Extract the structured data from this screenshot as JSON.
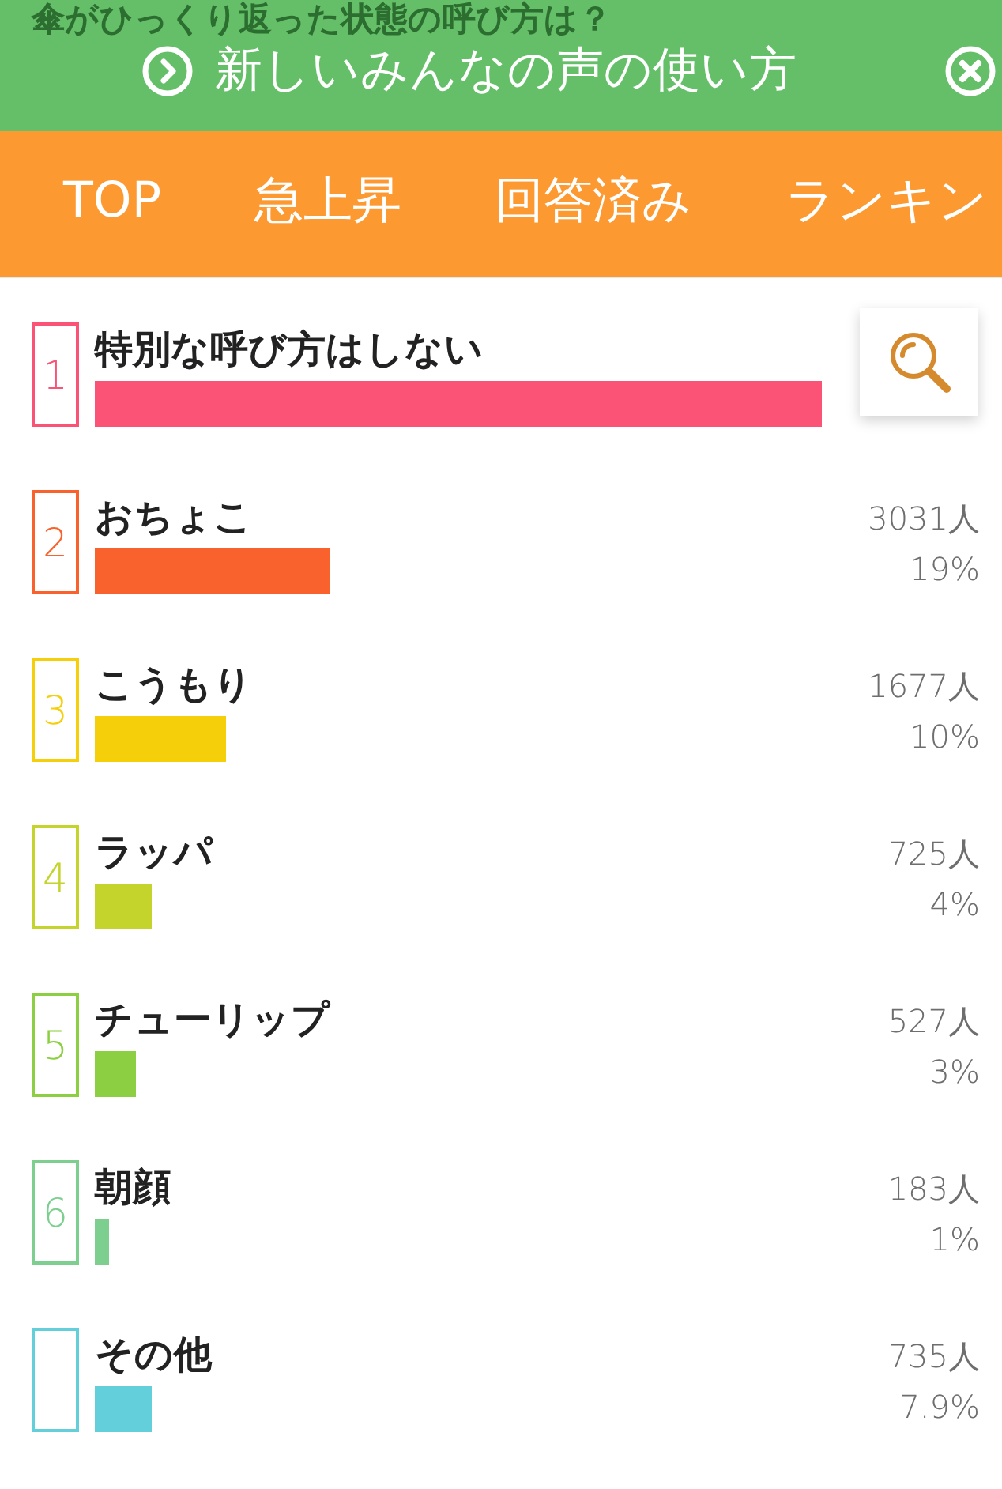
{
  "question_title": "傘がひっくり返った状態の呼び方は？",
  "banner": {
    "text": "新しいみんなの声の使い方"
  },
  "tabs": [
    {
      "label": "TOP",
      "selected": false
    },
    {
      "label": "急上昇",
      "selected": false
    },
    {
      "label": "回答済み",
      "selected": false
    },
    {
      "label": "ランキン",
      "selected": false
    }
  ],
  "answers": [
    {
      "rank": "1",
      "label": "特別な呼び方はしない",
      "level": 1,
      "color": "#fa5376"
    },
    {
      "rank": "2",
      "label": "おちょこ",
      "count": "3031人",
      "percent": "19%",
      "level": 0.324,
      "color": "#f9622c"
    },
    {
      "rank": "3",
      "label": "こうもり",
      "count": "1677人",
      "percent": "10%",
      "level": 0.18,
      "color": "#f5d00a"
    },
    {
      "rank": "4",
      "label": "ラッパ",
      "count": "725人",
      "percent": "4%",
      "level": 0.078,
      "color": "#c5d42c"
    },
    {
      "rank": "5",
      "label": "チューリップ",
      "count": "527人",
      "percent": "3%",
      "level": 0.057,
      "color": "#8dcf43"
    },
    {
      "rank": "6",
      "label": "朝顔",
      "count": "183人",
      "percent": "1%",
      "level": 0.02,
      "color": "#7ccf8f"
    },
    {
      "label": "その他",
      "count": "735人",
      "percent": "7.9%",
      "level": 0.078,
      "color": "#62cfdb"
    }
  ]
}
